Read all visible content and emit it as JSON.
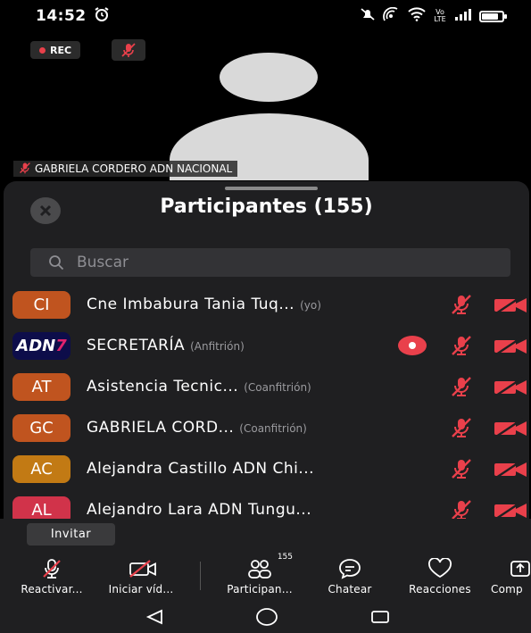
{
  "status_bar": {
    "time": "14:52",
    "left_icon": "alarm-icon",
    "right_icons": [
      "do-not-disturb-icon",
      "hotspot-icon",
      "wifi-icon",
      "volte-icon",
      "signal-icon",
      "battery-icon"
    ],
    "volte_label": "Vo LTE",
    "battery_level": 0.8
  },
  "video": {
    "rec_label": "REC",
    "speaker_name": "GABRIELA CORDERO ADN NACIONAL"
  },
  "participants_panel": {
    "title": "Participantes (155)",
    "search_placeholder": "Buscar",
    "rows": [
      {
        "initials": "CI",
        "color": "#c0541f",
        "name": "Cne Imbabura Tania Tuq...",
        "role": "(yo)",
        "recording": false
      },
      {
        "initials": "ADN7",
        "color": "#0d0d4a",
        "name": "SECRETARÍA",
        "role": "(Anfitrión)",
        "recording": true,
        "logo": true
      },
      {
        "initials": "AT",
        "color": "#c0541f",
        "name": "Asistencia Tecnic...",
        "role": "(Coanfitrión)",
        "recording": false
      },
      {
        "initials": "GC",
        "color": "#c0541f",
        "name": "GABRIELA CORD...",
        "role": "(Coanfitrión)",
        "recording": false
      },
      {
        "initials": "AC",
        "color": "#c27a14",
        "name": "Alejandra Castillo ADN Chi...",
        "role": "",
        "recording": false
      },
      {
        "initials": "AL",
        "color": "#d1334a",
        "name": "Alejandro Lara ADN Tungu...",
        "role": "",
        "recording": false
      }
    ]
  },
  "invite": {
    "label": "Invitar"
  },
  "toolbar": {
    "items": [
      {
        "label": "Reactivar...",
        "icon": "mic-muted-icon"
      },
      {
        "label": "Iniciar víd...",
        "icon": "video-off-icon"
      },
      {
        "label": "Participan...",
        "icon": "participants-icon",
        "count": "155"
      },
      {
        "label": "Chatear",
        "icon": "chat-icon"
      },
      {
        "label": "Reacciones",
        "icon": "heart-icon"
      },
      {
        "label": "Comp",
        "icon": "share-icon"
      }
    ]
  },
  "colors": {
    "accent_red": "#e9404b",
    "panel_bg": "#1f1f21"
  }
}
